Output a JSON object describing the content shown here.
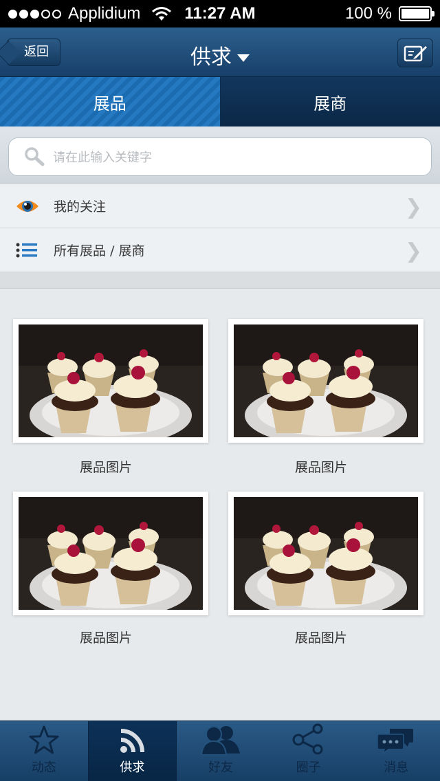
{
  "status_bar": {
    "carrier": "Applidium",
    "time": "11:27 AM",
    "battery": "100 %"
  },
  "nav": {
    "back_label": "返回",
    "title": "供求"
  },
  "segments": [
    {
      "label": "展品",
      "active": true
    },
    {
      "label": "展商",
      "active": false
    }
  ],
  "search": {
    "placeholder": "请在此输入关键字"
  },
  "menu": [
    {
      "label": "我的关注",
      "icon": "eye-icon"
    },
    {
      "label": "所有展品 / 展商",
      "icon": "list-icon"
    }
  ],
  "products": [
    {
      "caption": "展品图片"
    },
    {
      "caption": "展品图片"
    },
    {
      "caption": "展品图片"
    },
    {
      "caption": "展品图片"
    }
  ],
  "tabs": [
    {
      "label": "动态",
      "icon": "star-icon",
      "active": false
    },
    {
      "label": "供求",
      "icon": "rss-icon",
      "active": true
    },
    {
      "label": "好友",
      "icon": "friends-icon",
      "active": false
    },
    {
      "label": "圈子",
      "icon": "share-icon",
      "active": false
    },
    {
      "label": "消息",
      "icon": "chat-icon",
      "active": false
    }
  ],
  "colors": {
    "nav_bar": "#1f4d78",
    "segment_active": "#1f72b8",
    "segment_inactive": "#0f3154",
    "tab_active": "#0a2c4f"
  }
}
